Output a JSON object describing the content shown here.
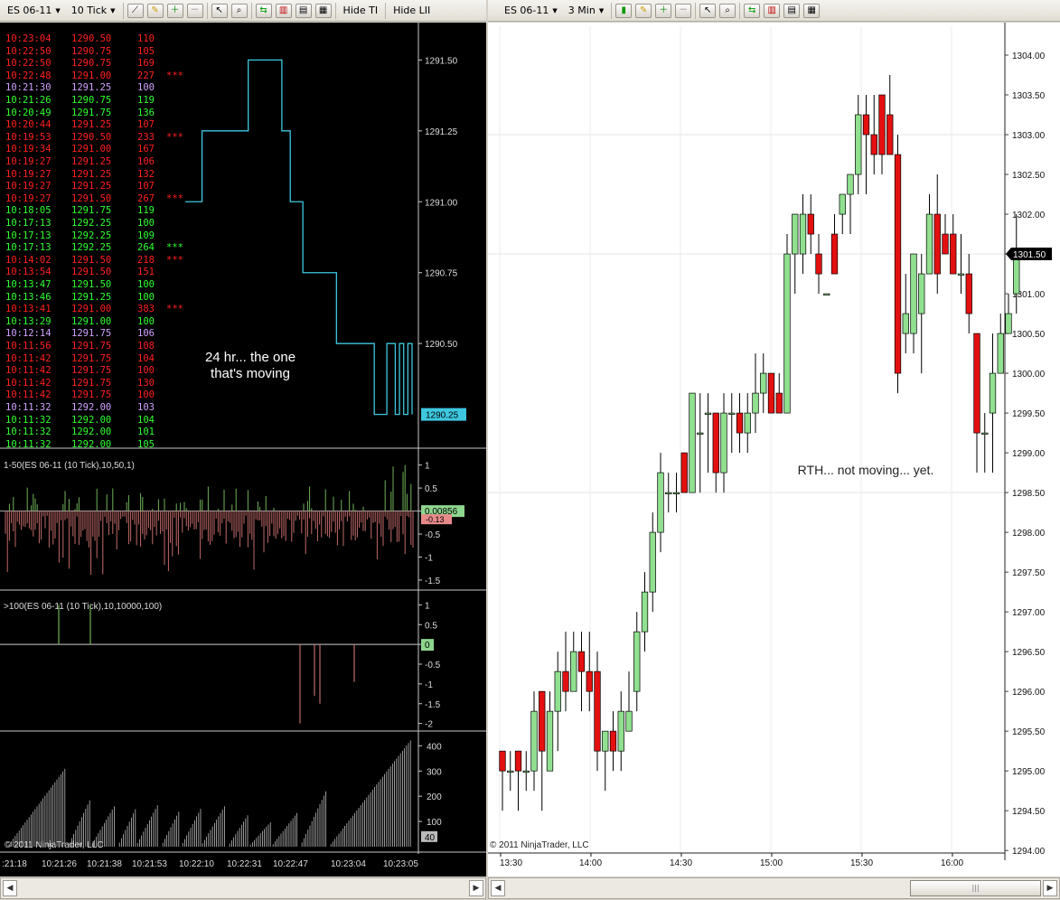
{
  "left_toolbar": {
    "instrument": "ES 06-11",
    "interval": "10 Tick",
    "hide_ti": "Hide TI",
    "hide_lii": "Hide LII"
  },
  "right_toolbar": {
    "instrument": "ES 06-11",
    "interval": "3 Min"
  },
  "colors": {
    "up": "#90e090",
    "down": "#e41010",
    "line": "#3ec8e0",
    "green_text": "#30ff30",
    "red_text": "#ff2020",
    "purple_text": "#d0a0ff"
  },
  "time_and_sales": [
    {
      "time": "10:23:04",
      "price": "1290.50",
      "size": "110",
      "flag": "",
      "color": "red"
    },
    {
      "time": "10:22:50",
      "price": "1290.75",
      "size": "105",
      "flag": "",
      "color": "red"
    },
    {
      "time": "10:22:50",
      "price": "1290.75",
      "size": "169",
      "flag": "",
      "color": "red"
    },
    {
      "time": "10:22:48",
      "price": "1291.00",
      "size": "227",
      "flag": "***",
      "color": "red"
    },
    {
      "time": "10:21:30",
      "price": "1291.25",
      "size": "100",
      "flag": "",
      "color": "purple"
    },
    {
      "time": "10:21:26",
      "price": "1290.75",
      "size": "119",
      "flag": "",
      "color": "green"
    },
    {
      "time": "10:20:49",
      "price": "1291.75",
      "size": "136",
      "flag": "",
      "color": "green"
    },
    {
      "time": "10:20:44",
      "price": "1291.25",
      "size": "107",
      "flag": "",
      "color": "red"
    },
    {
      "time": "10:19:53",
      "price": "1290.50",
      "size": "233",
      "flag": "***",
      "color": "red"
    },
    {
      "time": "10:19:34",
      "price": "1291.00",
      "size": "167",
      "flag": "",
      "color": "red"
    },
    {
      "time": "10:19:27",
      "price": "1291.25",
      "size": "106",
      "flag": "",
      "color": "red"
    },
    {
      "time": "10:19:27",
      "price": "1291.25",
      "size": "132",
      "flag": "",
      "color": "red"
    },
    {
      "time": "10:19:27",
      "price": "1291.25",
      "size": "107",
      "flag": "",
      "color": "red"
    },
    {
      "time": "10:19:27",
      "price": "1291.50",
      "size": "267",
      "flag": "***",
      "color": "red"
    },
    {
      "time": "10:18:05",
      "price": "1291.75",
      "size": "119",
      "flag": "",
      "color": "green"
    },
    {
      "time": "10:17:13",
      "price": "1292.25",
      "size": "100",
      "flag": "",
      "color": "green"
    },
    {
      "time": "10:17:13",
      "price": "1292.25",
      "size": "109",
      "flag": "",
      "color": "green"
    },
    {
      "time": "10:17:13",
      "price": "1292.25",
      "size": "264",
      "flag": "***",
      "color": "green"
    },
    {
      "time": "10:14:02",
      "price": "1291.50",
      "size": "218",
      "flag": "***",
      "color": "red"
    },
    {
      "time": "10:13:54",
      "price": "1291.50",
      "size": "151",
      "flag": "",
      "color": "red"
    },
    {
      "time": "10:13:47",
      "price": "1291.50",
      "size": "100",
      "flag": "",
      "color": "green"
    },
    {
      "time": "10:13:46",
      "price": "1291.25",
      "size": "100",
      "flag": "",
      "color": "green"
    },
    {
      "time": "10:13:41",
      "price": "1291.00",
      "size": "383",
      "flag": "***",
      "color": "red"
    },
    {
      "time": "10:13:29",
      "price": "1291.00",
      "size": "100",
      "flag": "",
      "color": "green"
    },
    {
      "time": "10:12:14",
      "price": "1291.75",
      "size": "106",
      "flag": "",
      "color": "purple"
    },
    {
      "time": "10:11:56",
      "price": "1291.75",
      "size": "108",
      "flag": "",
      "color": "red"
    },
    {
      "time": "10:11:42",
      "price": "1291.75",
      "size": "104",
      "flag": "",
      "color": "red"
    },
    {
      "time": "10:11:42",
      "price": "1291.75",
      "size": "100",
      "flag": "",
      "color": "red"
    },
    {
      "time": "10:11:42",
      "price": "1291.75",
      "size": "130",
      "flag": "",
      "color": "red"
    },
    {
      "time": "10:11:42",
      "price": "1291.75",
      "size": "100",
      "flag": "",
      "color": "red"
    },
    {
      "time": "10:11:32",
      "price": "1292.00",
      "size": "103",
      "flag": "",
      "color": "purple"
    },
    {
      "time": "10:11:32",
      "price": "1292.00",
      "size": "104",
      "flag": "",
      "color": "green"
    },
    {
      "time": "10:11:32",
      "price": "1292.00",
      "size": "101",
      "flag": "",
      "color": "green"
    },
    {
      "time": "10:11:32",
      "price": "1292.00",
      "size": "105",
      "flag": "",
      "color": "green"
    }
  ],
  "left_note": "24 hr... the one that's moving",
  "right_note": "RTH... not moving... yet.",
  "copyright": "© 2011 NinjaTrader, LLC",
  "chart_data": [
    {
      "type": "line",
      "name": "tick price",
      "ylim": [
        1290.15,
        1291.6
      ],
      "y_ticks": [
        "1291.50",
        "1291.25",
        "1291.00",
        "1290.75",
        "1290.50"
      ],
      "values": [
        1291.0,
        1291.0,
        1291.0,
        1291.0,
        1291.25,
        1291.25,
        1291.25,
        1291.25,
        1291.25,
        1291.25,
        1291.25,
        1291.25,
        1291.25,
        1291.25,
        1291.25,
        1291.5,
        1291.5,
        1291.5,
        1291.5,
        1291.5,
        1291.5,
        1291.5,
        1291.5,
        1291.25,
        1291.25,
        1291.0,
        1291.0,
        1291.0,
        1290.75,
        1290.75,
        1290.75,
        1290.75,
        1290.75,
        1290.75,
        1290.75,
        1290.75,
        1290.5,
        1290.5,
        1290.5,
        1290.5,
        1290.5,
        1290.5,
        1290.5,
        1290.5,
        1290.5,
        1290.25,
        1290.25,
        1290.25,
        1290.5,
        1290.5,
        1290.25,
        1290.5,
        1290.25,
        1290.5,
        1290.25
      ],
      "last_value": "1290.25"
    },
    {
      "type": "bar",
      "title": "1-50(ES 06-11 (10 Tick),10,50,1)",
      "ylim": [
        -1.6,
        1.15
      ],
      "y_ticks": [
        "1",
        "0.5",
        "0",
        "-0.5",
        "-1",
        "-1.5"
      ],
      "last_value": "0.00856",
      "second_value": "-0.13"
    },
    {
      "type": "bar",
      "title": ">100(ES 06-11 (10 Tick),10,10000,100)",
      "ylim": [
        -2.1,
        1.1
      ],
      "y_ticks": [
        "1",
        "0.5",
        "0",
        "-0.5",
        "-1",
        "-1.5",
        "-2"
      ],
      "last_value": "0",
      "spikes": [
        {
          "x": 65,
          "v": 1
        },
        {
          "x": 100,
          "v": 1
        },
        {
          "x": 332,
          "v": -2
        },
        {
          "x": 348,
          "v": -1.3
        },
        {
          "x": 354,
          "v": -1.5
        },
        {
          "x": 392,
          "v": -0.95
        }
      ]
    },
    {
      "type": "bar",
      "name": "volume",
      "ylim": [
        0,
        430
      ],
      "y_ticks": [
        "400",
        "300",
        "200",
        "100"
      ],
      "last_value": "40",
      "x_labels": [
        ":21:18",
        "10:21:26",
        "10:21:38",
        "10:21:53",
        "10:22:10",
        "10:22:31",
        "10:22:47",
        "10:23:04",
        "10:23:05"
      ]
    },
    {
      "type": "candlestick",
      "name": "ES 06-11 3 Min",
      "ylim": [
        1293.9,
        1304.25
      ],
      "y_ticks": [
        "1304.00",
        "1303.50",
        "1303.00",
        "1302.50",
        "1302.00",
        "1301.50",
        "1301.00",
        "1300.50",
        "1300.00",
        "1299.50",
        "1299.00",
        "1298.50",
        "1298.00",
        "1297.50",
        "1297.00",
        "1296.50",
        "1296.00",
        "1295.50",
        "1295.00",
        "1294.50",
        "1294.00"
      ],
      "x_labels": [
        "13:30",
        "14:00",
        "14:30",
        "15:00",
        "15:30",
        "16:00"
      ],
      "last_value": "1301.50",
      "ohlc": [
        [
          1295.25,
          1295.25,
          1294.5,
          1295.0
        ],
        [
          1295.0,
          1295.25,
          1294.75,
          1295.0
        ],
        [
          1295.25,
          1295.25,
          1294.5,
          1295.0
        ],
        [
          1295.0,
          1295.25,
          1294.75,
          1295.0
        ],
        [
          1295.0,
          1296.0,
          1294.75,
          1295.75
        ],
        [
          1296.0,
          1296.0,
          1294.5,
          1295.25
        ],
        [
          1295.0,
          1296.0,
          1295.0,
          1295.75
        ],
        [
          1295.75,
          1296.5,
          1295.25,
          1296.25
        ],
        [
          1296.25,
          1296.75,
          1295.75,
          1296.0
        ],
        [
          1296.0,
          1296.75,
          1296.0,
          1296.5
        ],
        [
          1296.5,
          1296.75,
          1295.75,
          1296.25
        ],
        [
          1296.25,
          1296.75,
          1295.75,
          1296.0
        ],
        [
          1296.25,
          1296.5,
          1295.0,
          1295.25
        ],
        [
          1295.25,
          1295.5,
          1294.75,
          1295.5
        ],
        [
          1295.5,
          1295.75,
          1295.0,
          1295.25
        ],
        [
          1295.25,
          1296.0,
          1295.0,
          1295.75
        ],
        [
          1295.5,
          1296.25,
          1295.5,
          1295.75
        ],
        [
          1296.0,
          1297.0,
          1295.75,
          1296.75
        ],
        [
          1296.75,
          1297.5,
          1296.5,
          1297.25
        ],
        [
          1297.25,
          1298.25,
          1297.0,
          1298.0
        ],
        [
          1298.0,
          1299.0,
          1297.75,
          1298.75
        ],
        [
          1298.5,
          1298.75,
          1298.25,
          1298.5
        ],
        [
          1298.5,
          1298.75,
          1298.25,
          1298.5
        ],
        [
          1299.0,
          1299.0,
          1298.5,
          1298.5
        ],
        [
          1298.5,
          1299.75,
          1298.5,
          1299.75
        ],
        [
          1299.25,
          1299.75,
          1298.5,
          1299.25
        ],
        [
          1299.5,
          1299.75,
          1298.75,
          1299.5
        ],
        [
          1299.5,
          1299.5,
          1298.5,
          1298.75
        ],
        [
          1298.75,
          1299.75,
          1298.5,
          1299.5
        ],
        [
          1299.5,
          1299.75,
          1299.0,
          1299.5
        ],
        [
          1299.5,
          1299.75,
          1299.0,
          1299.25
        ],
        [
          1299.25,
          1299.75,
          1299.0,
          1299.5
        ],
        [
          1299.5,
          1300.25,
          1299.25,
          1299.75
        ],
        [
          1299.75,
          1300.25,
          1299.5,
          1300.0
        ],
        [
          1300.0,
          1300.0,
          1299.5,
          1299.5
        ],
        [
          1299.75,
          1300.0,
          1299.5,
          1299.5
        ],
        [
          1299.5,
          1301.75,
          1299.5,
          1301.5
        ],
        [
          1301.5,
          1302.0,
          1301.0,
          1302.0
        ],
        [
          1301.5,
          1302.25,
          1301.25,
          1302.0
        ],
        [
          1302.0,
          1302.25,
          1301.5,
          1301.75
        ],
        [
          1301.5,
          1301.75,
          1301.0,
          1301.25
        ],
        [
          1301.0,
          1301.0,
          1301.0,
          1301.0
        ],
        [
          1301.75,
          1302.0,
          1301.25,
          1301.25
        ],
        [
          1302.0,
          1302.25,
          1301.75,
          1302.25
        ],
        [
          1302.25,
          1302.5,
          1301.75,
          1302.5
        ],
        [
          1302.5,
          1303.5,
          1302.25,
          1303.25
        ],
        [
          1303.25,
          1303.5,
          1302.25,
          1303.0
        ],
        [
          1303.0,
          1303.5,
          1302.5,
          1302.75
        ],
        [
          1303.5,
          1303.5,
          1302.5,
          1302.75
        ],
        [
          1303.25,
          1303.75,
          1302.75,
          1302.75
        ],
        [
          1302.75,
          1303.0,
          1299.75,
          1300.0
        ],
        [
          1300.5,
          1301.25,
          1300.25,
          1300.75
        ],
        [
          1300.5,
          1301.5,
          1300.25,
          1301.5
        ],
        [
          1300.75,
          1301.5,
          1300.0,
          1301.25
        ],
        [
          1301.25,
          1302.25,
          1301.25,
          1302.0
        ],
        [
          1302.0,
          1302.5,
          1301.0,
          1301.25
        ],
        [
          1301.75,
          1302.0,
          1301.5,
          1301.5
        ],
        [
          1301.75,
          1302.0,
          1301.25,
          1301.25
        ],
        [
          1301.25,
          1301.75,
          1301.0,
          1301.25
        ],
        [
          1301.25,
          1301.5,
          1300.5,
          1300.75
        ],
        [
          1300.5,
          1300.5,
          1298.75,
          1299.25
        ],
        [
          1299.25,
          1299.5,
          1298.75,
          1299.25
        ],
        [
          1299.5,
          1300.5,
          1298.75,
          1300.0
        ],
        [
          1300.0,
          1300.75,
          1300.0,
          1300.5
        ],
        [
          1300.5,
          1301.0,
          1300.5,
          1300.75
        ],
        [
          1301.0,
          1302.0,
          1300.75,
          1301.5
        ]
      ]
    }
  ]
}
